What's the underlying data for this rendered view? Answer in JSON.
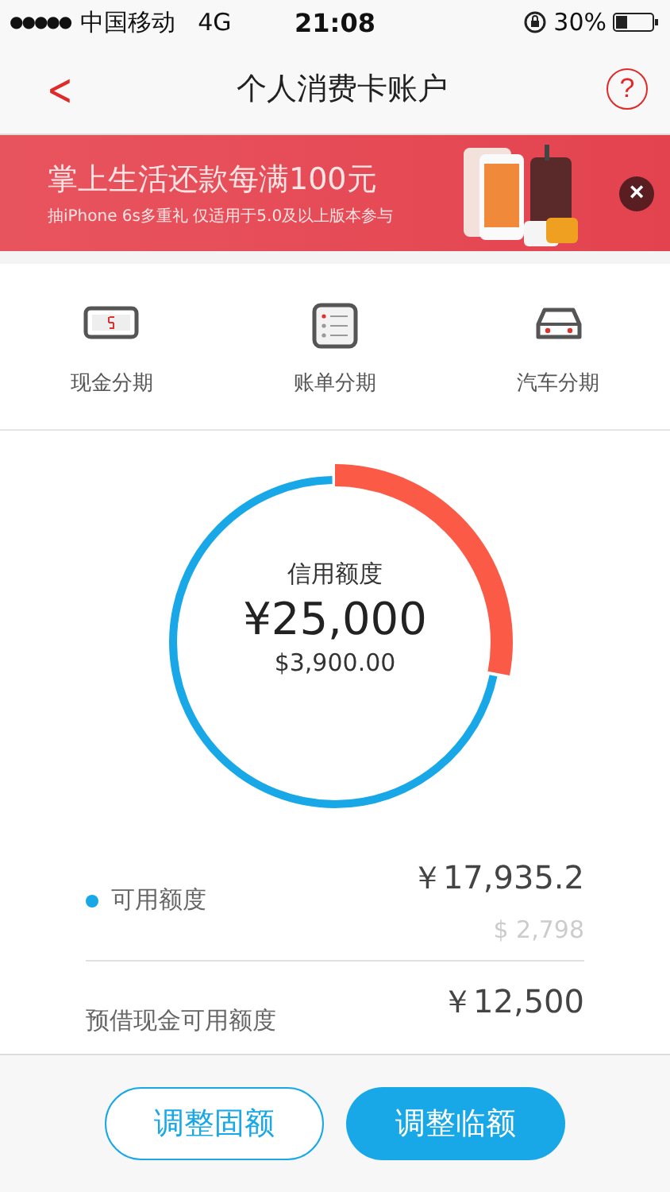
{
  "status_bar": {
    "signal": "●●●●●",
    "carrier": "中国移动",
    "network": "4G",
    "time": "21:08",
    "battery": "30%"
  },
  "nav": {
    "back": "<",
    "title": "个人消费卡账户",
    "help": "?"
  },
  "banner": {
    "headline": "掌上生活还款每满100元",
    "subline": "抽iPhone 6s多重礼 仅适用于5.0及以上版本参与",
    "close": "×"
  },
  "shortcuts": [
    {
      "kind": "cash",
      "label": "现金分期"
    },
    {
      "kind": "bill",
      "label": "账单分期"
    },
    {
      "kind": "car",
      "label": "汽车分期"
    }
  ],
  "credit": {
    "label": "信用额度",
    "amount": "¥25,000",
    "amount_usd": "$3,900.00",
    "level": 0.28
  },
  "rows": [
    {
      "label": "可用额度",
      "color": "#18a8e8",
      "value": "￥17,935.2",
      "value_usd": "$ 2,798"
    },
    {
      "label": "预借现金可用额度",
      "value": "￥12,500"
    }
  ],
  "buttons": [
    {
      "label": "调整固额",
      "kind": "outline"
    },
    {
      "label": "调整临额",
      "kind": "filled"
    }
  ]
}
